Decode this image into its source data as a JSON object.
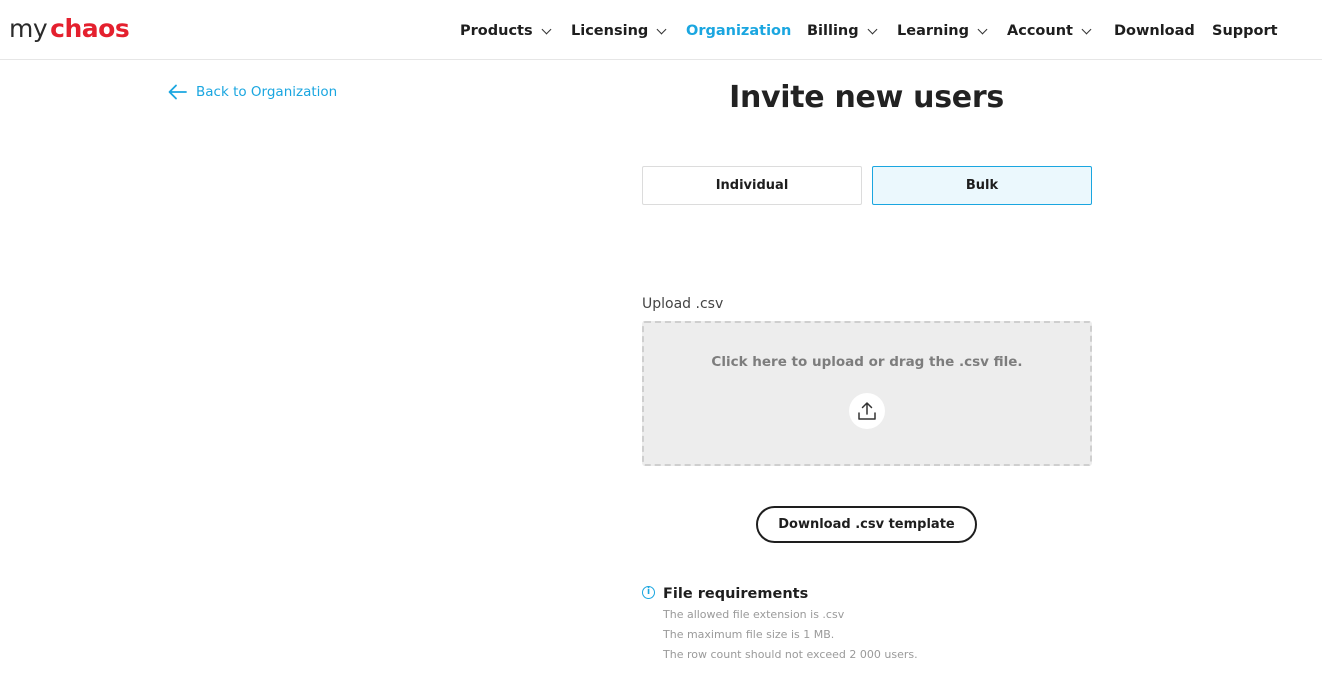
{
  "logo": {
    "my": "my",
    "chaos": "chaos"
  },
  "nav": {
    "products": "Products",
    "licensing": "Licensing",
    "organization": "Organization",
    "billing": "Billing",
    "learning": "Learning",
    "account": "Account",
    "download": "Download",
    "support": "Support"
  },
  "back_link": "Back to Organization",
  "title": "Invite new users",
  "tabs": {
    "individual": "Individual",
    "bulk": "Bulk"
  },
  "upload": {
    "label": "Upload .csv",
    "dropzone_text": "Click here to upload or drag the .csv file."
  },
  "download_template": "Download .csv template",
  "requirements": {
    "icon": "i",
    "title": "File requirements",
    "lines": [
      "The allowed file extension is .csv",
      "The maximum file size is 1 MB.",
      "The row count should not exceed 2 000 users."
    ]
  },
  "colors": {
    "accent": "#1aa6e0",
    "brand_red": "#e4202e"
  }
}
